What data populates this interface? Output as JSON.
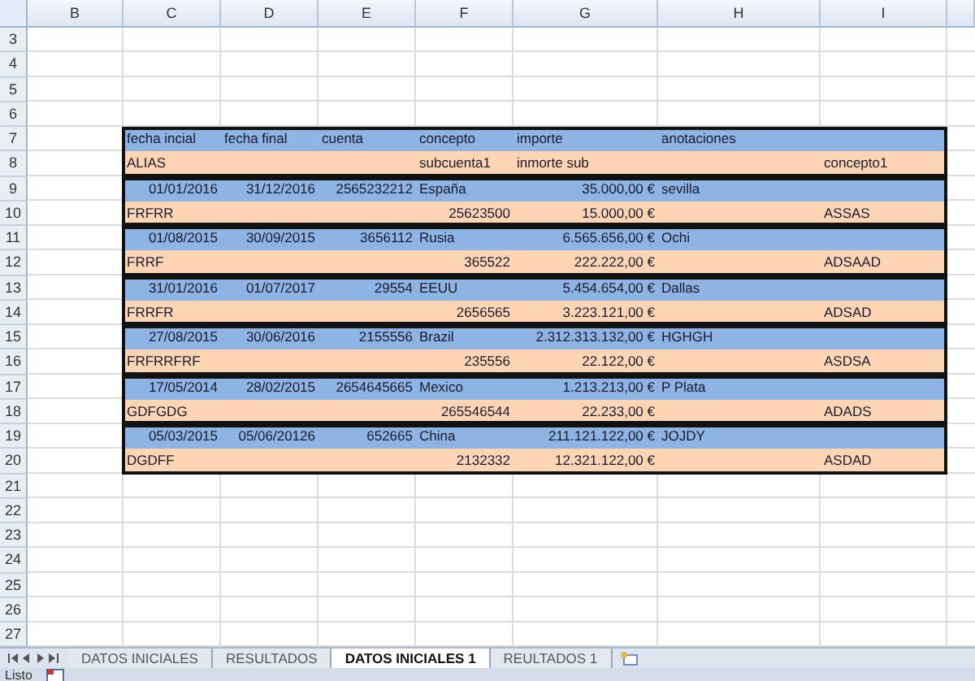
{
  "columns": [
    "B",
    "C",
    "D",
    "E",
    "F",
    "G",
    "H",
    "I"
  ],
  "rows": [
    "3",
    "4",
    "5",
    "6",
    "7",
    "8",
    "9",
    "10",
    "11",
    "12",
    "13",
    "14",
    "15",
    "16",
    "17",
    "18",
    "19",
    "20",
    "21",
    "22",
    "23",
    "24",
    "25",
    "26",
    "27"
  ],
  "records": [
    {
      "main": {
        "col_c": {
          "text": "fecha incial",
          "kind": "text"
        },
        "col_d": {
          "text": "fecha final",
          "kind": "text"
        },
        "col_e": {
          "text": "cuenta",
          "kind": "text"
        },
        "col_f": {
          "text": "concepto",
          "kind": "text"
        },
        "col_g": {
          "text": "importe",
          "kind": "text"
        },
        "col_h": {
          "text": "anotaciones",
          "kind": "text"
        }
      },
      "sub": {
        "col_c": {
          "text": "ALIAS",
          "kind": "text"
        },
        "col_f": {
          "text": "subcuenta1",
          "kind": "text"
        },
        "col_g": {
          "text": "inmorte sub",
          "kind": "text"
        },
        "col_i": {
          "text": "concepto1",
          "kind": "text"
        }
      }
    },
    {
      "main": {
        "col_c": {
          "text": "01/01/2016",
          "kind": "number"
        },
        "col_d": {
          "text": "31/12/2016",
          "kind": "number"
        },
        "col_e": {
          "text": "2565232212",
          "kind": "number"
        },
        "col_f": {
          "text": "España",
          "kind": "text"
        },
        "col_g": {
          "text": "35.000,00 €",
          "kind": "number"
        },
        "col_h": {
          "text": "sevilla",
          "kind": "text"
        }
      },
      "sub": {
        "col_c": {
          "text": "FRFRR",
          "kind": "text"
        },
        "col_f": {
          "text": "25623500",
          "kind": "number"
        },
        "col_g": {
          "text": "15.000,00 €",
          "kind": "number"
        },
        "col_i": {
          "text": "ASSAS",
          "kind": "text"
        }
      }
    },
    {
      "main": {
        "col_c": {
          "text": "01/08/2015",
          "kind": "number"
        },
        "col_d": {
          "text": "30/09/2015",
          "kind": "number"
        },
        "col_e": {
          "text": "3656112",
          "kind": "number"
        },
        "col_f": {
          "text": "Rusia",
          "kind": "text"
        },
        "col_g": {
          "text": "6.565.656,00 €",
          "kind": "number"
        },
        "col_h": {
          "text": "Ochi",
          "kind": "text"
        }
      },
      "sub": {
        "col_c": {
          "text": "FRRF",
          "kind": "text"
        },
        "col_f": {
          "text": "365522",
          "kind": "number"
        },
        "col_g": {
          "text": "222.222,00 €",
          "kind": "number"
        },
        "col_i": {
          "text": "ADSAAD",
          "kind": "text"
        }
      }
    },
    {
      "main": {
        "col_c": {
          "text": "31/01/2016",
          "kind": "number"
        },
        "col_d": {
          "text": "01/07/2017",
          "kind": "number"
        },
        "col_e": {
          "text": "29554",
          "kind": "number"
        },
        "col_f": {
          "text": "EEUU",
          "kind": "text"
        },
        "col_g": {
          "text": "5.454.654,00 €",
          "kind": "number"
        },
        "col_h": {
          "text": "Dallas",
          "kind": "text"
        }
      },
      "sub": {
        "col_c": {
          "text": "FRRFR",
          "kind": "text"
        },
        "col_f": {
          "text": "2656565",
          "kind": "number"
        },
        "col_g": {
          "text": "3.223.121,00 €",
          "kind": "number"
        },
        "col_i": {
          "text": "ADSAD",
          "kind": "text"
        }
      }
    },
    {
      "main": {
        "col_c": {
          "text": "27/08/2015",
          "kind": "number"
        },
        "col_d": {
          "text": "30/06/2016",
          "kind": "number"
        },
        "col_e": {
          "text": "2155556",
          "kind": "number"
        },
        "col_f": {
          "text": "Brazil",
          "kind": "text"
        },
        "col_g": {
          "text": "2.312.313.132,00 €",
          "kind": "number"
        },
        "col_h": {
          "text": "HGHGH",
          "kind": "text"
        }
      },
      "sub": {
        "col_c": {
          "text": "FRFRRFRF",
          "kind": "text"
        },
        "col_f": {
          "text": "235556",
          "kind": "number"
        },
        "col_g": {
          "text": "22.122,00 €",
          "kind": "number"
        },
        "col_i": {
          "text": "ASDSA",
          "kind": "text"
        }
      }
    },
    {
      "main": {
        "col_c": {
          "text": "17/05/2014",
          "kind": "number"
        },
        "col_d": {
          "text": "28/02/2015",
          "kind": "number"
        },
        "col_e": {
          "text": "2654645665",
          "kind": "number"
        },
        "col_f": {
          "text": "Mexico",
          "kind": "text"
        },
        "col_g": {
          "text": "1.213.213,00 €",
          "kind": "number"
        },
        "col_h": {
          "text": "P Plata",
          "kind": "text"
        }
      },
      "sub": {
        "col_c": {
          "text": "GDFGDG",
          "kind": "text"
        },
        "col_f": {
          "text": "265546544",
          "kind": "number"
        },
        "col_g": {
          "text": "22.233,00 €",
          "kind": "number"
        },
        "col_i": {
          "text": "ADADS",
          "kind": "text"
        }
      }
    },
    {
      "main": {
        "col_c": {
          "text": "05/03/2015",
          "kind": "number"
        },
        "col_d": {
          "text": "05/06/20126",
          "kind": "number"
        },
        "col_e": {
          "text": "652665",
          "kind": "number"
        },
        "col_f": {
          "text": "China",
          "kind": "text"
        },
        "col_g": {
          "text": "211.121.122,00 €",
          "kind": "number"
        },
        "col_h": {
          "text": "JOJDY",
          "kind": "text"
        }
      },
      "sub": {
        "col_c": {
          "text": "DGDFF",
          "kind": "text"
        },
        "col_f": {
          "text": "2132332",
          "kind": "number"
        },
        "col_g": {
          "text": "12.321.122,00 €",
          "kind": "number"
        },
        "col_i": {
          "text": "ASDAD",
          "kind": "text"
        }
      }
    }
  ],
  "sheet_tabs": [
    {
      "label": "DATOS INICIALES",
      "selected": false
    },
    {
      "label": "RESULTADOS",
      "selected": false
    },
    {
      "label": "DATOS INICIALES 1",
      "selected": true
    },
    {
      "label": "REULTADOS 1",
      "selected": false
    }
  ],
  "status_bar": {
    "text": "Listo"
  }
}
